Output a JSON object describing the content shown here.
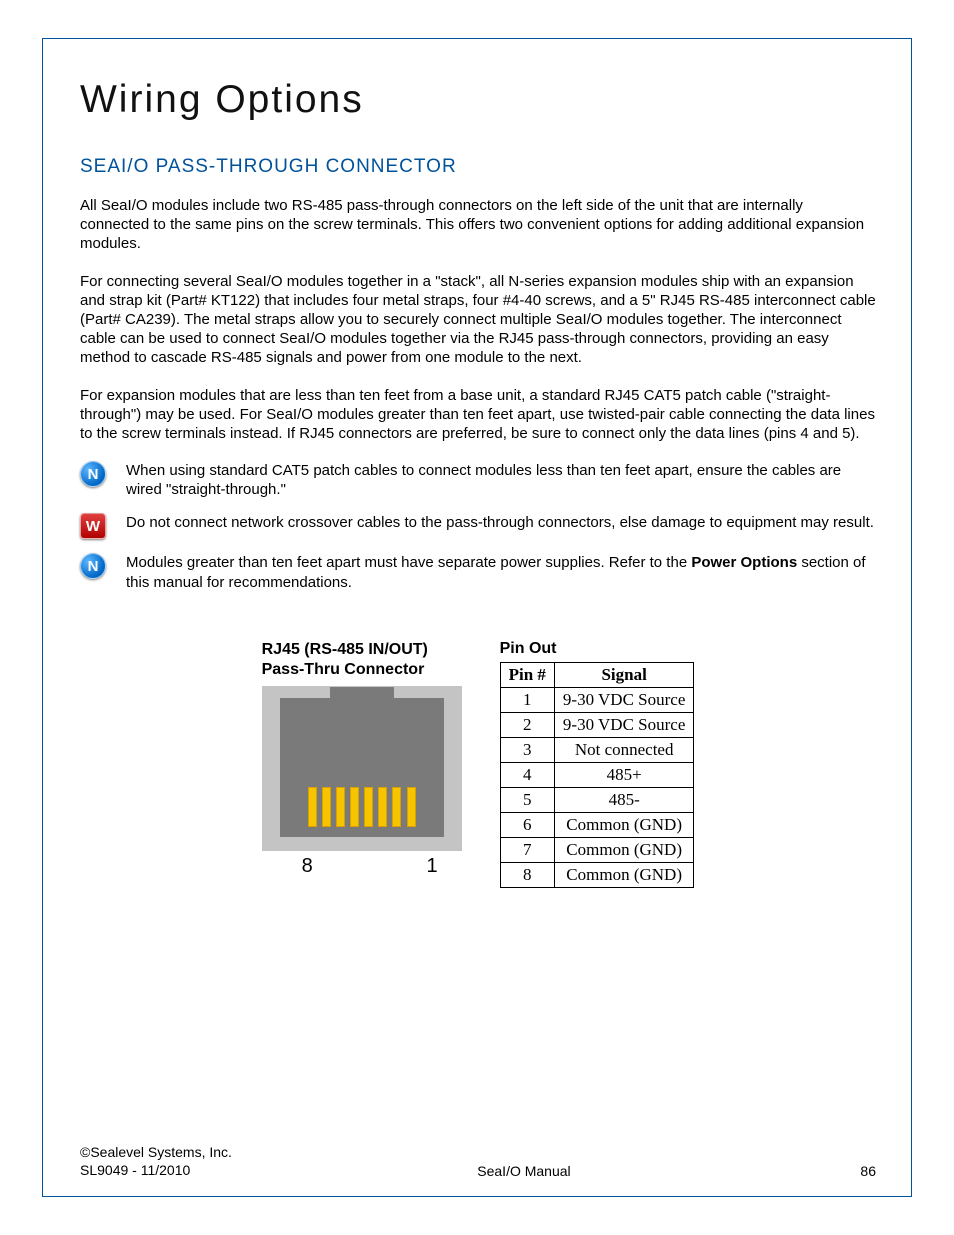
{
  "headings": {
    "title": "Wiring Options",
    "section": "SeaI/O Pass-Through Connector"
  },
  "paragraphs": {
    "p1": "All SeaI/O modules include two RS-485 pass-through connectors on the left side of the unit that are internally connected to the same pins on the screw terminals. This offers two convenient options for adding additional expansion modules.",
    "p2": "For connecting several SeaI/O modules together in a \"stack\", all N-series expansion modules ship with an expansion and strap kit (Part# KT122) that includes four metal straps, four #4-40 screws, and a 5\" RJ45 RS-485 interconnect cable (Part# CA239). The metal straps allow you to securely connect multiple SeaI/O modules together. The interconnect cable can be used to connect SeaI/O modules together via the RJ45 pass-through connectors, providing an easy method to cascade RS-485 signals and power from one module to the next.",
    "p3": "For expansion modules that are less than ten feet from a base unit, a standard RJ45 CAT5 patch cable (\"straight-through\") may be used.  For SeaI/O modules greater than ten feet apart, use twisted-pair cable connecting the data lines to the screw terminals instead.  If RJ45 connectors are preferred, be sure to connect only the data lines (pins 4 and 5)."
  },
  "notes": [
    {
      "type": "N",
      "text": "When using standard CAT5 patch cables to connect modules less than ten feet apart, ensure the cables are wired \"straight-through.\""
    },
    {
      "type": "W",
      "text": "Do not connect network crossover cables to the pass-through connectors, else damage to equipment may result."
    },
    {
      "type": "N",
      "text_pre": "Modules greater than ten feet apart must have separate power supplies. Refer to the ",
      "bold": "Power Options",
      "text_post": " section of this manual for recommendations."
    }
  ],
  "connector": {
    "title_line1": "RJ45 (RS-485 IN/OUT)",
    "title_line2": "Pass-Thru Connector",
    "left_label": "8",
    "right_label": "1"
  },
  "pinout": {
    "title": "Pin Out",
    "headers": {
      "pin": "Pin #",
      "signal": "Signal"
    },
    "rows": [
      {
        "pin": "1",
        "signal": "9-30 VDC Source"
      },
      {
        "pin": "2",
        "signal": "9-30 VDC Source"
      },
      {
        "pin": "3",
        "signal": "Not connected"
      },
      {
        "pin": "4",
        "signal": "485+"
      },
      {
        "pin": "5",
        "signal": "485-"
      },
      {
        "pin": "6",
        "signal": "Common (GND)"
      },
      {
        "pin": "7",
        "signal": "Common (GND)"
      },
      {
        "pin": "8",
        "signal": "Common (GND)"
      }
    ]
  },
  "footer": {
    "copyright": "©Sealevel Systems, Inc.",
    "docnum": "SL9049 - 11/2010",
    "center": "SeaI/O Manual",
    "page": "86"
  }
}
